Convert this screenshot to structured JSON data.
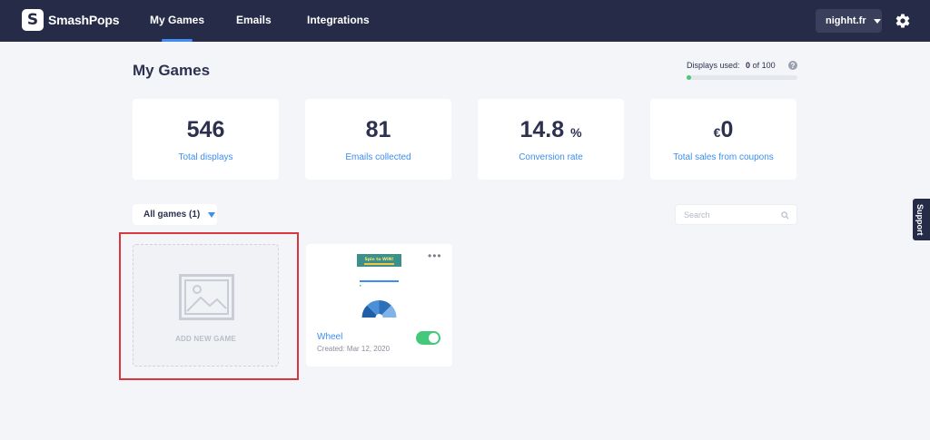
{
  "brand": {
    "logo_letter": "S",
    "name": "SmashPops"
  },
  "nav": {
    "items": [
      {
        "label": "My Games",
        "active": true
      },
      {
        "label": "Emails",
        "active": false
      },
      {
        "label": "Integrations",
        "active": false
      }
    ],
    "store": "nighht.fr",
    "settings_icon": "gear-icon"
  },
  "page": {
    "title": "My Games"
  },
  "usage": {
    "label": "Displays used:",
    "used": "0",
    "of_total": "of 100",
    "help": "?",
    "fraction_used": 0.0
  },
  "stats": [
    {
      "value": "546",
      "suffix": "",
      "prefix": "",
      "label": "Total displays"
    },
    {
      "value": "81",
      "suffix": "",
      "prefix": "",
      "label": "Emails collected"
    },
    {
      "value": "14.8",
      "suffix": "%",
      "prefix": "",
      "label": "Conversion rate"
    },
    {
      "value": "0",
      "suffix": "",
      "prefix": "€",
      "label": "Total sales from coupons"
    }
  ],
  "filter": {
    "label": "All games (1)"
  },
  "search": {
    "placeholder": "Search",
    "icon": "search-icon"
  },
  "support": {
    "label": "Support"
  },
  "add_card": {
    "label": "ADD NEW GAME",
    "icon": "image-placeholder-icon"
  },
  "games": [
    {
      "name": "Wheel",
      "created": "Created: Mar 12, 2020",
      "enabled": true,
      "thumbnail_title": "Spin to WIN!"
    }
  ],
  "colors": {
    "nav_bg": "#262b48",
    "accent": "#3d8ef0",
    "success": "#44c97a",
    "highlight": "#d9363e"
  }
}
